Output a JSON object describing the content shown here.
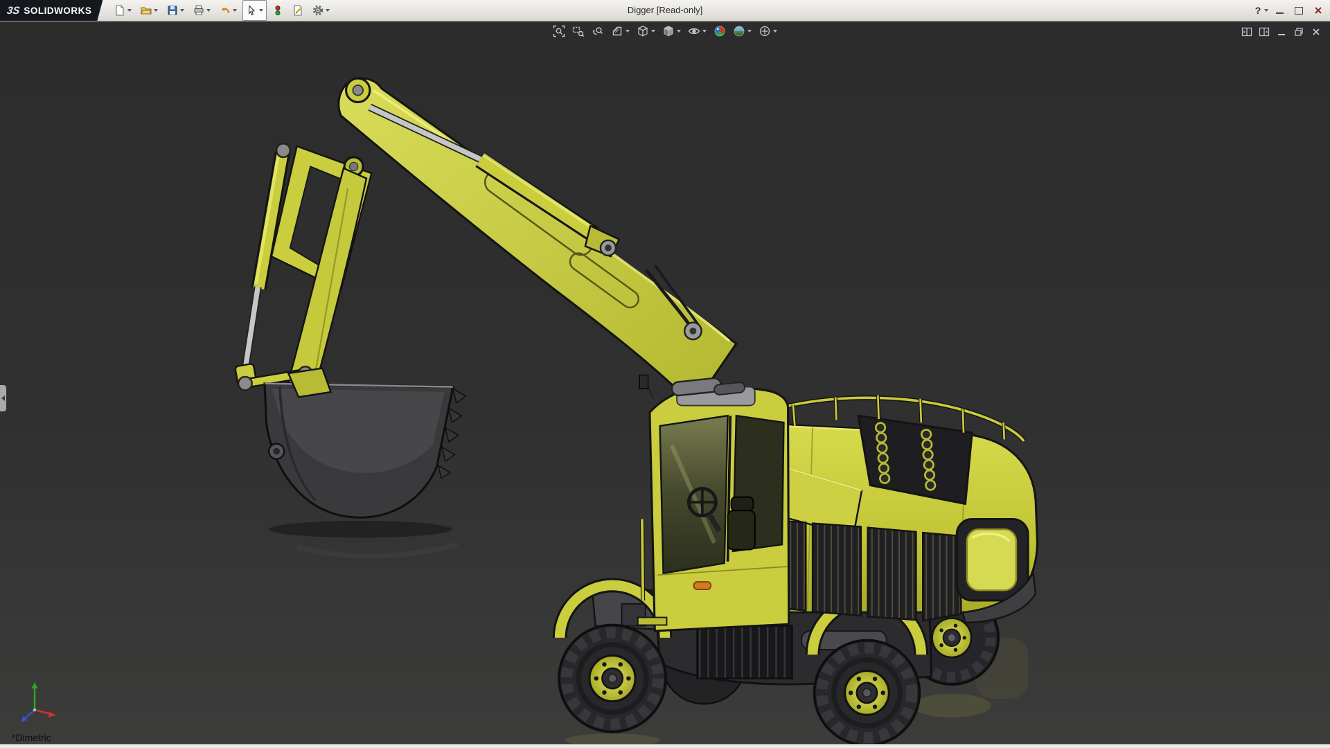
{
  "app": {
    "brand_mark": "3S",
    "brand": "SOLIDWORKS",
    "title": "Digger [Read-only]"
  },
  "titlebar": {
    "help_label": "?",
    "tools": [
      {
        "name": "new-document-icon",
        "dropdown": true
      },
      {
        "name": "open-icon",
        "dropdown": true
      },
      {
        "name": "save-icon",
        "dropdown": true
      },
      {
        "name": "print-icon",
        "dropdown": true
      },
      {
        "name": "undo-icon",
        "dropdown": true
      },
      {
        "name": "select-cursor-icon",
        "dropdown": true,
        "pressed": true
      },
      {
        "name": "rebuild-icon",
        "dropdown": false
      },
      {
        "name": "file-properties-icon",
        "dropdown": false
      },
      {
        "name": "options-gear-icon",
        "dropdown": true
      }
    ],
    "window_controls": [
      "minimize",
      "maximize",
      "close"
    ]
  },
  "headsup_toolbar": {
    "items": [
      {
        "name": "zoom-to-fit-icon",
        "dropdown": false
      },
      {
        "name": "zoom-to-area-icon",
        "dropdown": false
      },
      {
        "name": "previous-view-icon",
        "dropdown": false
      },
      {
        "name": "section-view-icon",
        "dropdown": true
      },
      {
        "name": "view-orientation-icon",
        "dropdown": true
      },
      {
        "name": "display-style-icon",
        "dropdown": true
      },
      {
        "name": "hide-show-items-icon",
        "dropdown": true
      },
      {
        "name": "edit-appearance-icon",
        "dropdown": false
      },
      {
        "name": "apply-scene-icon",
        "dropdown": true
      },
      {
        "name": "view-settings-icon",
        "dropdown": true
      }
    ]
  },
  "document_controls": [
    "pane-split-left-icon",
    "pane-split-right-icon",
    "minimize-doc-icon",
    "restore-doc-icon",
    "close-doc-icon"
  ],
  "viewport": {
    "view_orientation_label": "*Dimetric",
    "model": "digger-excavator",
    "background_top": "#2c2c2d",
    "background_bottom": "#3c3c3b",
    "colors": {
      "body_yellow": "#c9cd3e",
      "highlight_yellow": "#e9ec74",
      "shadow_yellow": "#a9ad2a",
      "metal_gray": "#9a9a9c",
      "dark_gray": "#2b2b2e",
      "tire_black": "#26262a",
      "rod_silver": "#c6c6c6"
    }
  },
  "triad": {
    "x_color": "#cc3333",
    "y_color": "#2fa32f",
    "z_color": "#3355cc"
  }
}
